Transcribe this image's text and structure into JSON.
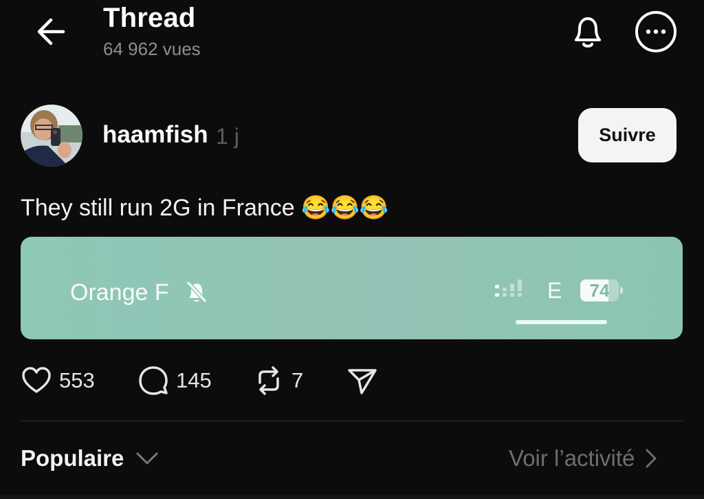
{
  "header": {
    "title": "Thread",
    "views": "64 962 vues",
    "icons": {
      "back": "arrow-left-icon",
      "notifications": "bell-icon",
      "more": "more-options-icon"
    }
  },
  "post": {
    "username": "haamfish",
    "age": "1 j",
    "follow_label": "Suivre",
    "text": "They still run 2G in France 😂😂😂",
    "media": {
      "carrier": "Orange F",
      "network_type": "E",
      "battery_level": "74",
      "battery_fraction": 0.74,
      "background_color": "#8ec8b7"
    },
    "actions": {
      "likes": "553",
      "replies": "145",
      "reposts": "7"
    }
  },
  "footer": {
    "sort_label": "Populaire",
    "activity_label": "Voir l’activité"
  }
}
